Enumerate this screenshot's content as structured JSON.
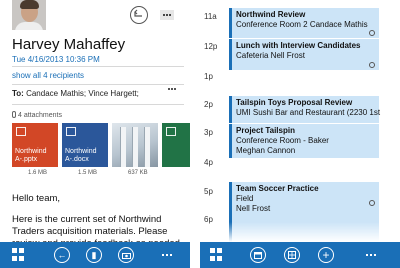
{
  "mail": {
    "sender": "Harvey Mahaffey",
    "meta": "Tue 4/16/2013 10:36 PM",
    "show_all": "show all 4 recipients",
    "to_label": "To:",
    "to_value": "Candace Mathis; Vince Hargett;",
    "attachments_count": "4 attachments",
    "attachments": [
      {
        "label_line1": "Northwind",
        "label_line2": "A-.pptx",
        "size": "1.6 MB",
        "color": "#d24726"
      },
      {
        "label_line1": "Northwind",
        "label_line2": "A-.docx",
        "size": "1.5 MB",
        "color": "#2b579a"
      },
      {
        "label_line1": "",
        "label_line2": "",
        "size": "637 KB",
        "color": "#b7c4cf"
      },
      {
        "label_line1": "",
        "label_line2": "",
        "size": "",
        "color": "#217346"
      }
    ],
    "greeting": "Hello team,",
    "body_line1": "Here is the current set of Northwind",
    "body_line2": "Traders acquisition materials.  Please",
    "body_line3": "review and provide feedback as needed"
  },
  "mail_appbar": {
    "icons": [
      "windows-icon",
      "back-icon",
      "delete-icon",
      "camera-icon",
      "more-icon"
    ],
    "back_glyph": "←",
    "delete_glyph": "▮"
  },
  "calendar": {
    "hours": [
      "11a",
      "12p",
      "1p",
      "2p",
      "3p",
      "4p",
      "5p",
      "6p"
    ],
    "appointments": [
      {
        "title": "Northwind Review",
        "subtitle": "Conference Room 2 Candace Mathis",
        "subtitle2": ""
      },
      {
        "title": "Lunch with Interview Candidates",
        "subtitle": "Cafeteria Nell Frost",
        "subtitle2": ""
      },
      {
        "title": "Tailspin Toys Proposal Review",
        "subtitle": "UMI Sushi Bar and Restaurant (2230 1st",
        "subtitle2": ""
      },
      {
        "title": "Project Tailspin",
        "subtitle": "Conference Room - Baker",
        "subtitle2": "Meghan Cannon"
      },
      {
        "title": "Team Soccer Practice",
        "subtitle": "Field",
        "subtitle2": "Nell Frost"
      }
    ]
  },
  "cal_appbar": {
    "icons": [
      "windows-icon",
      "calendar-today-icon",
      "calendar-grid-icon",
      "add-icon",
      "more-icon"
    ],
    "add_glyph": "+"
  },
  "colors": {
    "accent": "#1a6fb7",
    "appointment_fill": "#cce4f7"
  }
}
